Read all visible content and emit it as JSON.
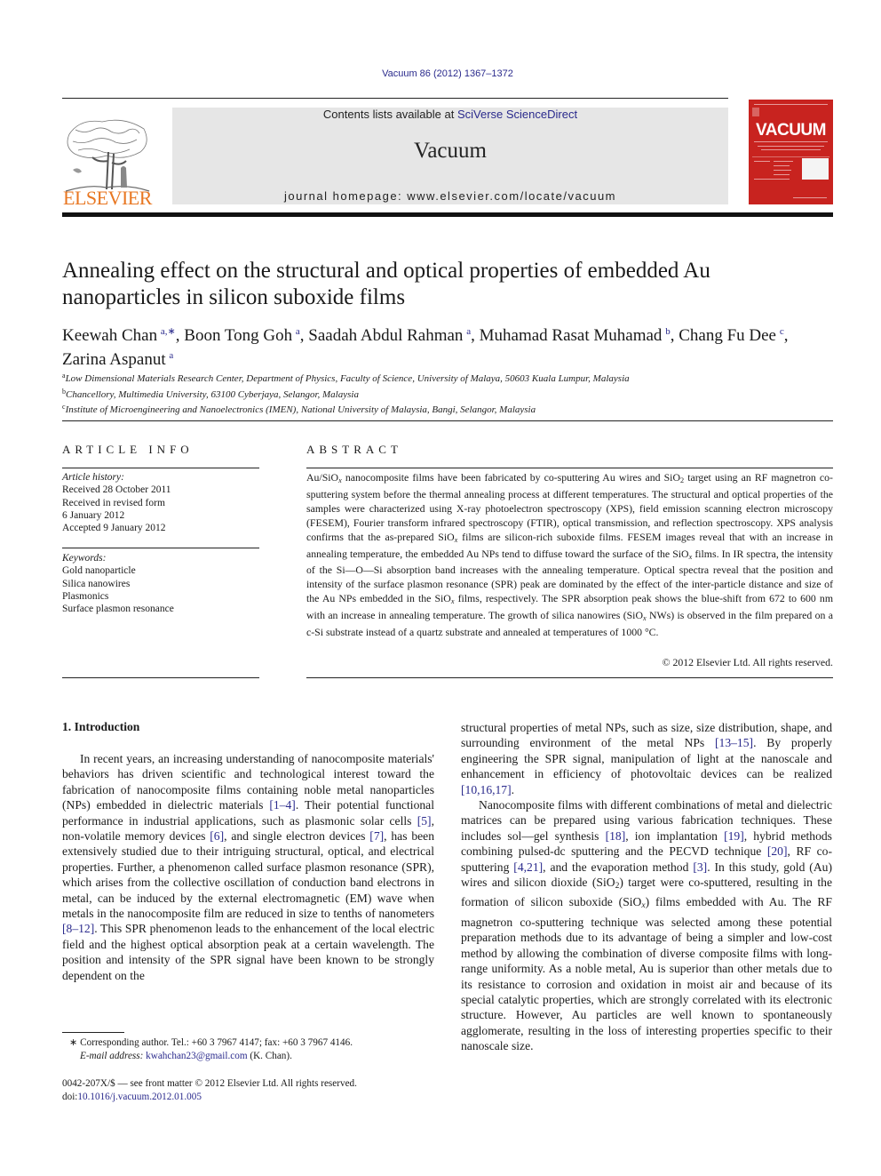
{
  "header": {
    "citation": "Vacuum 86 (2012) 1367–1372",
    "contents_prefix": "Contents lists available at ",
    "contents_link": "SciVerse ScienceDirect",
    "journal_title": "Vacuum",
    "homepage": "journal homepage: www.elsevier.com/locate/vacuum",
    "publisher_logo_text": "ELSEVIER",
    "cover_title": "VACUUM",
    "colors": {
      "publisher_orange": "#e87722",
      "cover_red": "#c8231f",
      "link_blue": "#2a2a8c",
      "banner_gray": "#e6e6e6"
    }
  },
  "article": {
    "title": "Annealing effect on the structural and optical properties of embedded Au nanoparticles in silicon suboxide films",
    "authors": [
      {
        "name": "Keewah Chan",
        "sup": "a,∗",
        "sep": ", "
      },
      {
        "name": "Boon Tong Goh",
        "sup": "a",
        "sep": ", "
      },
      {
        "name": "Saadah Abdul Rahman",
        "sup": "a",
        "sep": ", "
      },
      {
        "name": "Muhamad Rasat Muhamad",
        "sup": "b",
        "sep": ", "
      },
      {
        "name": "Chang Fu Dee",
        "sup": "c",
        "sep": ","
      },
      {
        "name": "Zarina Aspanut",
        "sup": "a",
        "sep": ""
      }
    ],
    "affiliations": [
      {
        "key": "a",
        "text": "Low Dimensional Materials Research Center, Department of Physics, Faculty of Science, University of Malaya, 50603 Kuala Lumpur, Malaysia"
      },
      {
        "key": "b",
        "text": "Chancellory, Multimedia University, 63100 Cyberjaya, Selangor, Malaysia"
      },
      {
        "key": "c",
        "text": "Institute of Microengineering and Nanoelectronics (IMEN), National University of Malaysia, Bangi, Selangor, Malaysia"
      }
    ]
  },
  "article_info": {
    "heading": "ARTICLE INFO",
    "history_label": "Article history:",
    "history": [
      "Received 28 October 2011",
      "Received in revised form",
      "6 January 2012",
      "Accepted 9 January 2012"
    ],
    "keywords_label": "Keywords:",
    "keywords": [
      "Gold nanoparticle",
      "Silica nanowires",
      "Plasmonics",
      "Surface plasmon resonance"
    ]
  },
  "abstract": {
    "heading": "ABSTRACT",
    "parts": [
      "Au/SiO",
      "x",
      " nanocomposite films have been fabricated by co-sputtering Au wires and SiO",
      "2",
      " target using an RF magnetron co-sputtering system before the thermal annealing process at different temperatures. The structural and optical properties of the samples were characterized using X-ray photoelectron spectroscopy (XPS), field emission scanning electron microscopy (FESEM), Fourier transform infrared spectroscopy (FTIR), optical transmission, and reflection spectroscopy. XPS analysis confirms that the as-prepared SiO",
      "x",
      " films are silicon-rich suboxide films. FESEM images reveal that with an increase in annealing temperature, the embedded Au NPs tend to diffuse toward the surface of the SiO",
      "x",
      " films. In IR spectra, the intensity of the Si—O—Si absorption band increases with the annealing temperature. Optical spectra reveal that the position and intensity of the surface plasmon resonance (SPR) peak are dominated by the effect of the inter-particle distance and size of the Au NPs embedded in the SiO",
      "x",
      " films, respectively. The SPR absorption peak shows the blue-shift from 672 to 600 nm with an increase in annealing temperature. The growth of silica nanowires (SiO",
      "x",
      " NWs) is observed in the film prepared on a c-Si substrate instead of a quartz substrate and annealed at temperatures of 1000 °C."
    ],
    "copyright": "© 2012 Elsevier Ltd. All rights reserved."
  },
  "body": {
    "section_heading": "1.  Introduction",
    "left_p1": [
      "In recent years, an increasing understanding of nanocomposite materials' behaviors has driven scientific and technological interest toward the fabrication of nanocomposite films containing noble metal nanoparticles (NPs) embedded in dielectric materials ",
      "[1–4]",
      ". Their potential functional performance in industrial applications, such as plasmonic solar cells ",
      "[5]",
      ", non-volatile memory devices ",
      "[6]",
      ", and single electron devices ",
      "[7]",
      ", has been extensively studied due to their intriguing structural, optical, and electrical properties. Further, a phenomenon called surface plasmon resonance (SPR), which arises from the collective oscillation of conduction band electrons in metal, can be induced by the external electromagnetic (EM) wave when metals in the nanocomposite film are reduced in size to tenths of nanometers ",
      "[8–12]",
      ". This SPR phenomenon leads to the enhancement of the local electric field and the highest optical absorption peak at a certain wavelength. The position and intensity of the SPR signal have been known to be strongly dependent on the"
    ],
    "right_p1": [
      "structural properties of metal NPs, such as size, size distribution, shape, and surrounding environment of the metal NPs ",
      "[13–15]",
      ". By properly engineering the SPR signal, manipulation of light at the nanoscale and enhancement in efficiency of photovoltaic devices can be realized ",
      "[10,16,17]",
      "."
    ],
    "right_p2": [
      "Nanocomposite films with different combinations of metal and dielectric matrices can be prepared using various fabrication techniques. These includes sol—gel synthesis ",
      "[18]",
      ", ion implantation ",
      "[19]",
      ", hybrid methods combining pulsed-dc sputtering and the PECVD technique ",
      "[20]",
      ", RF co-sputtering ",
      "[4,21]",
      ", and the evaporation method ",
      "[3]",
      ". In this study, gold (Au) wires and silicon dioxide (SiO",
      "2",
      ") target were co-sputtered, resulting in the formation of silicon suboxide (SiO",
      "x",
      ") films embedded with Au. The RF magnetron co-sputtering technique was selected among these potential preparation methods due to its advantage of being a simpler and low-cost method by allowing the combination of diverse composite films with long-range uniformity. As a noble metal, Au is superior than other metals due to its resistance to corrosion and oxidation in moist air and because of its special catalytic properties, which are strongly correlated with its electronic structure. However, Au particles are well known to spontaneously agglomerate, resulting in the loss of interesting properties specific to their nanoscale size."
    ]
  },
  "footnote": {
    "marker": "∗",
    "text": " Corresponding author. Tel.: +60 3 7967 4147; fax: +60 3 7967 4146.",
    "email_label": "E-mail address: ",
    "email": "kwahchan23@gmail.com",
    "email_suffix": " (K. Chan)."
  },
  "issn": {
    "line1": "0042-207X/$ — see front matter © 2012 Elsevier Ltd. All rights reserved.",
    "doi_label": "doi:",
    "doi": "10.1016/j.vacuum.2012.01.005"
  }
}
